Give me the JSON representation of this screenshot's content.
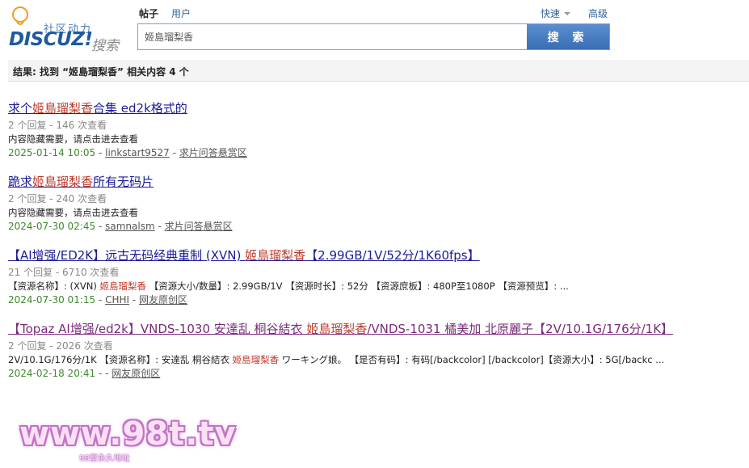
{
  "header": {
    "logo": {
      "community": "社区动力",
      "brand": "DISCUZ!",
      "brand_search": "搜索"
    },
    "type_tabs": [
      {
        "label": "帖子",
        "active": true
      },
      {
        "label": "用户",
        "active": false
      }
    ],
    "links": {
      "quick": "快速",
      "advanced": "高级"
    },
    "search": {
      "value": "姬島瑠梨香",
      "button": "搜 索"
    }
  },
  "result_summary": "结果: 找到 “姬島瑠梨香” 相关内容 4 个",
  "results": [
    {
      "title_pre": "求个",
      "title_hl": "姬島瑠梨香",
      "title_post": "合集 ed2k格式的",
      "meta": "2 个回复 - 146 次查看",
      "snippet_pre": "内容隐藏需要，请点击进去查看",
      "snippet_hl": "",
      "snippet_post": "",
      "date": "2025-01-14 10:05",
      "author": "linkstart9527",
      "forum": "求片问答悬赏区"
    },
    {
      "title_pre": "跪求",
      "title_hl": "姬島瑠梨香",
      "title_post": "所有无码片",
      "meta": "2 个回复 - 240 次查看",
      "snippet_pre": "内容隐藏需要，请点击进去查看",
      "snippet_hl": "",
      "snippet_post": "",
      "date": "2024-07-30 02:45",
      "author": "samnalsm",
      "forum": "求片问答悬赏区"
    },
    {
      "title_pre": "【AI增强/ED2K】远古无码经典重制 (XVN) ",
      "title_hl": "姬島瑠梨香",
      "title_post": "【2.99GB/1V/52分/1K60fps】",
      "meta": "21 个回复 - 6710 次查看",
      "snippet_pre": "【资源名称】: (XVN) ",
      "snippet_hl": "姬島瑠梨香",
      "snippet_post": " 【资源大小/数量】: 2.99GB/1V 【资源时长】: 52分 【资源庶板】: 480P至1080P 【资源预览】: ...",
      "date": "2024-07-30 01:15",
      "author": "CHHI",
      "forum": "网友原创区"
    },
    {
      "title_pre": "【Topaz AI增强/ed2k】VNDS-1030 安達乱 桐谷結衣 ",
      "title_hl": "姬島瑠梨香",
      "title_post": "/VNDS-1031 橘美加 北原麗子【2V/10.1G/176分/1K】",
      "meta": "2 个回复 - 2026 次查看",
      "snippet_pre": "2V/10.1G/176分/1K 【资源名称】: 安達乱 桐谷結衣 ",
      "snippet_hl": "姬島瑠梨香",
      "snippet_post": " ワーキング娘。 【是否有码】: 有码[/backcolor] [/backcolor]【资源大小】: 5G[/backc ...",
      "date": "2024-02-18 20:41",
      "author": "",
      "forum": "网友原创区"
    }
  ],
  "watermark": {
    "text": "www.98t.tv",
    "sub": "98堂永久地址"
  },
  "colors": {
    "accent": "#3a6fb5",
    "highlight": "#c0392b",
    "date_green": "#3d8a2d",
    "link_blue": "#1b1b9a"
  }
}
